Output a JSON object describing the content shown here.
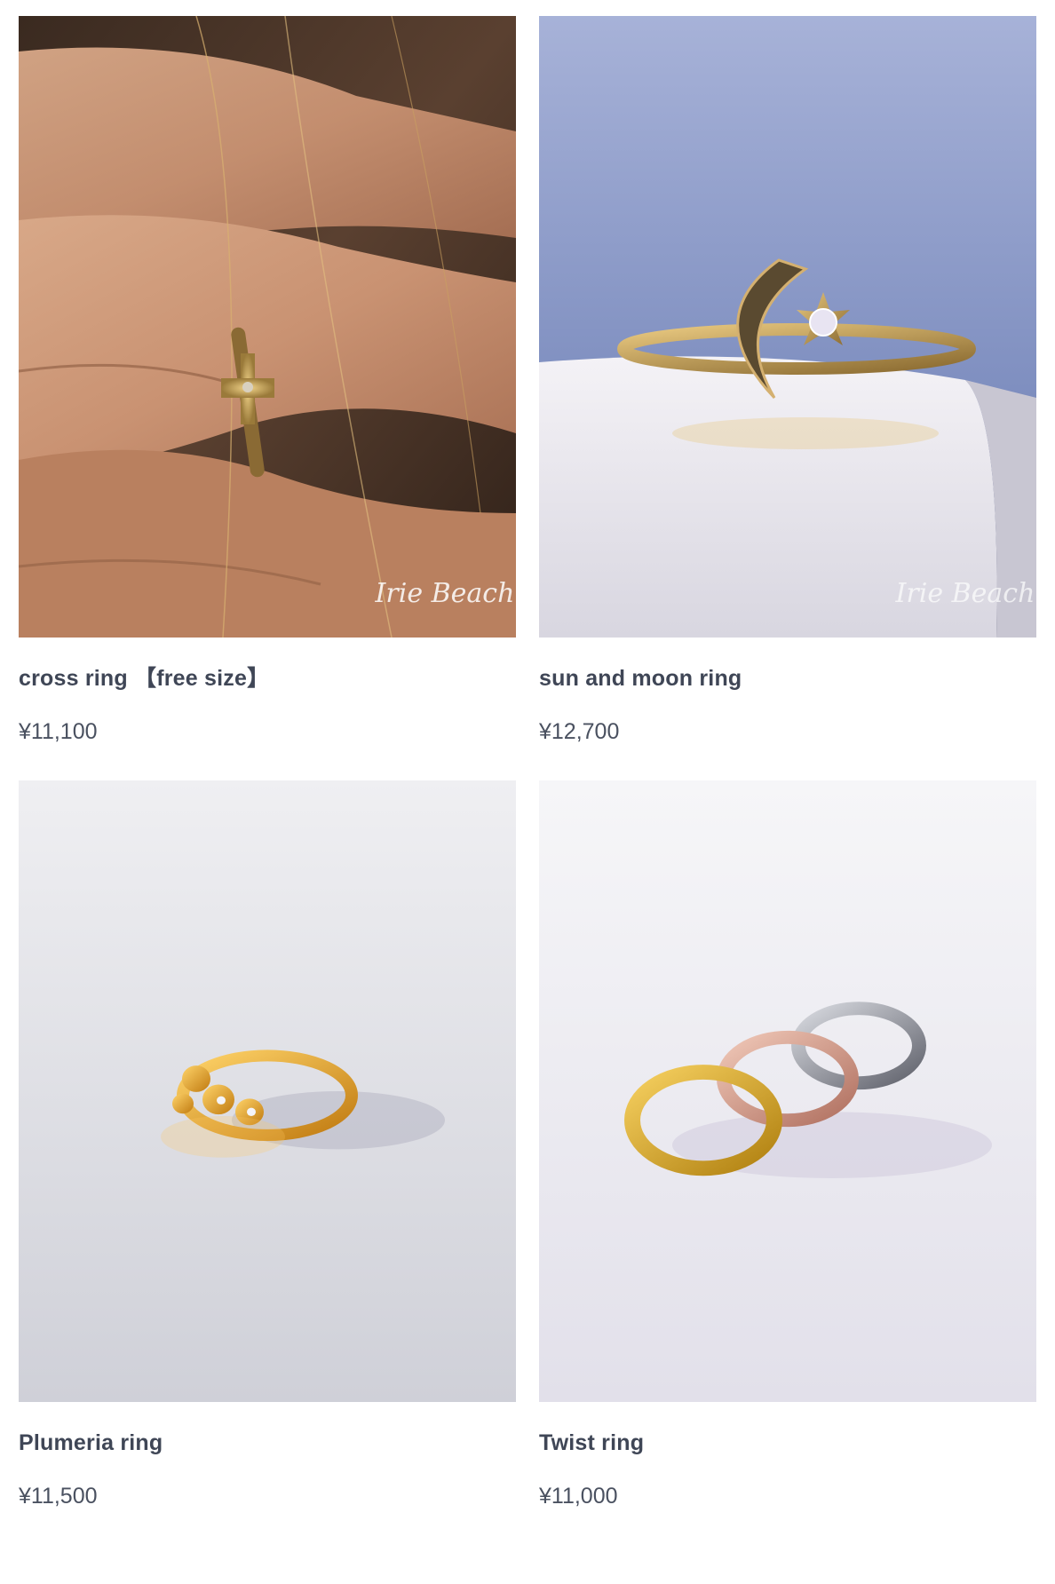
{
  "products": [
    {
      "name": "cross ring 【free size】",
      "price": "¥11,100",
      "image_icon": "cross-ring-photo",
      "watermark": "Irie Beach"
    },
    {
      "name": "sun and moon ring",
      "price": "¥12,700",
      "image_icon": "sun-moon-ring-photo",
      "watermark": "Irie Beach"
    },
    {
      "name": "Plumeria ring",
      "price": "¥11,500",
      "image_icon": "plumeria-ring-photo"
    },
    {
      "name": "Twist ring",
      "price": "¥11,000",
      "image_icon": "twist-ring-photo"
    }
  ],
  "colors": {
    "text": "#3f4656",
    "price": "#4a5160",
    "background": "#ffffff"
  }
}
